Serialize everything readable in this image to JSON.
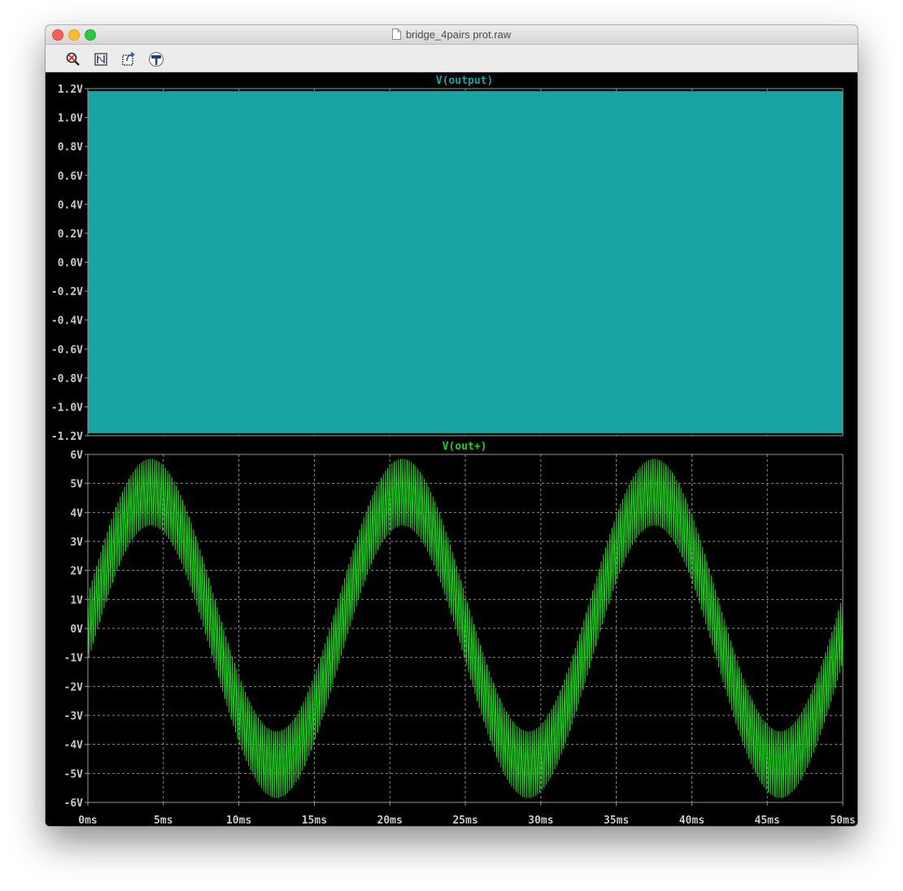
{
  "window": {
    "title": "bridge_4pairs prot.raw"
  },
  "toolbar": {
    "buttons": [
      {
        "name": "zoom-cancel",
        "icon": "zoom-cancel-icon"
      },
      {
        "name": "autorange",
        "icon": "autorange-icon"
      },
      {
        "name": "undo-zoom",
        "icon": "undo-zoom-icon"
      },
      {
        "name": "annotate",
        "icon": "hammer-icon"
      }
    ]
  },
  "colors": {
    "background": "#000000",
    "grid": "#8c8c8c",
    "axis_text": "#c8c8c8",
    "output_trace": "#1aa3a3",
    "outplus_trace": "#22cc22"
  },
  "chart_data": [
    {
      "type": "line",
      "title": "V(output)",
      "title_color": "#1aa3a3",
      "x_unit": "ms",
      "xlim": [
        0,
        50
      ],
      "ylim": [
        -1.2,
        1.2
      ],
      "yticks": [
        "1.2V",
        "1.0V",
        "0.8V",
        "0.6V",
        "0.4V",
        "0.2V",
        "0.0V",
        "-0.2V",
        "-0.4V",
        "-0.6V",
        "-0.8V",
        "-1.0V",
        "-1.2V"
      ],
      "ytick_values": [
        1.2,
        1.0,
        0.8,
        0.6,
        0.4,
        0.2,
        0.0,
        -0.2,
        -0.4,
        -0.6,
        -0.8,
        -1.0,
        -1.2
      ],
      "grid": true,
      "series": [
        {
          "description": "square wave switching between -1.18V and +1.18V at high frequency across 0–50ms",
          "high": 1.18,
          "low": -1.18
        }
      ]
    },
    {
      "type": "line",
      "title": "V(out+)",
      "title_color": "#22cc22",
      "x_unit": "ms",
      "xlim": [
        0,
        50
      ],
      "ylim": [
        -6,
        6
      ],
      "yticks": [
        "6V",
        "5V",
        "4V",
        "3V",
        "2V",
        "1V",
        "0V",
        "-1V",
        "-2V",
        "-3V",
        "-4V",
        "-5V",
        "-6V"
      ],
      "ytick_values": [
        6,
        5,
        4,
        3,
        2,
        1,
        0,
        -1,
        -2,
        -3,
        -4,
        -5,
        -6
      ],
      "xticks": [
        "0ms",
        "5ms",
        "10ms",
        "15ms",
        "20ms",
        "25ms",
        "30ms",
        "35ms",
        "40ms",
        "45ms",
        "50ms"
      ],
      "xtick_values": [
        0,
        5,
        10,
        15,
        20,
        25,
        30,
        35,
        40,
        45,
        50
      ],
      "grid": true,
      "series": [
        {
          "description": "60Hz sine of amplitude ~4.7V with high-frequency ripple band ~2.3V wide",
          "amplitude": 4.7,
          "ripple_pp": 2.3,
          "sine_period_ms": 16.67
        }
      ]
    }
  ]
}
